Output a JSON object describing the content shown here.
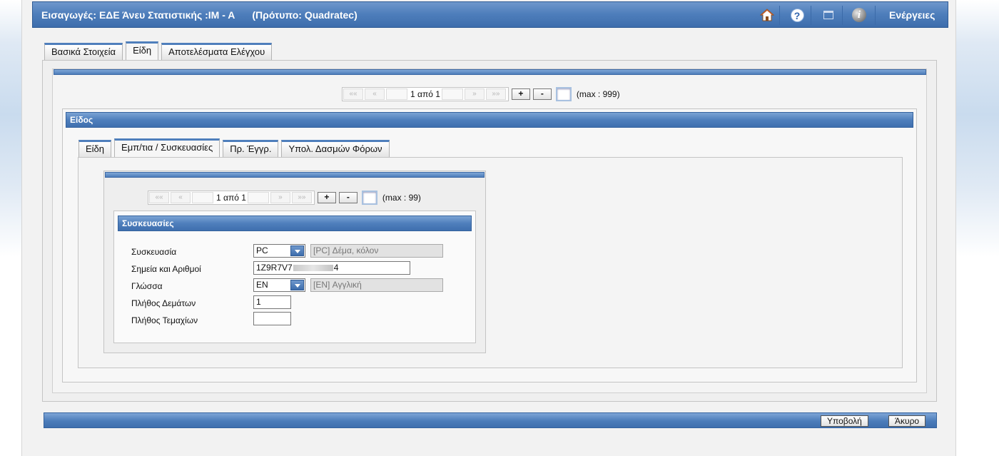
{
  "header": {
    "title": "Εισαγωγές: ΕΔΕ Άνευ Στατιστικής :IM - A",
    "template": "(Πρότυπο: Quadratec)",
    "actions_label": "Ενέργειες",
    "icons": [
      "home-icon",
      "help-icon",
      "window-icon",
      "info-icon"
    ]
  },
  "main_tabs": [
    {
      "label": "Βασικά Στοιχεία"
    },
    {
      "label": "Είδη"
    },
    {
      "label": "Αποτελέσματα Ελέγχου"
    }
  ],
  "outer_pager": {
    "first": "««",
    "prev": "«",
    "next": "»",
    "last": "»»",
    "status": "1 από 1",
    "add": "+",
    "remove": "-",
    "max": "(max : 999)"
  },
  "item_section": {
    "title": "Είδος"
  },
  "inner_tabs": [
    {
      "label": "Είδη"
    },
    {
      "label": "Εμπ/τια / Συσκευασίες"
    },
    {
      "label": "Πρ. Έγγρ."
    },
    {
      "label": "Υπολ. Δασμών Φόρων"
    }
  ],
  "inner_pager": {
    "first": "««",
    "prev": "«",
    "next": "»",
    "last": "»»",
    "status": "1 από 1",
    "add": "+",
    "remove": "-",
    "max": "(max : 99)"
  },
  "packages": {
    "title": "Συσκευασίες",
    "package_label": "Συσκευασία",
    "package_value": "PC",
    "package_desc": "[PC] Δέμα, κόλον",
    "marks_label": "Σημεία και Αριθμοί",
    "marks_value_start": "1Z9R7V7",
    "marks_value_end": "4",
    "language_label": "Γλώσσα",
    "language_value": "EN",
    "language_desc": "[EN] Αγγλική",
    "parcels_label": "Πλήθος Δεμάτων",
    "parcels_value": "1",
    "pieces_label": "Πλήθος Τεμαχίων",
    "pieces_value": ""
  },
  "footer": {
    "submit_label": "Υποβολή",
    "cancel_label": "Άκυρο"
  }
}
